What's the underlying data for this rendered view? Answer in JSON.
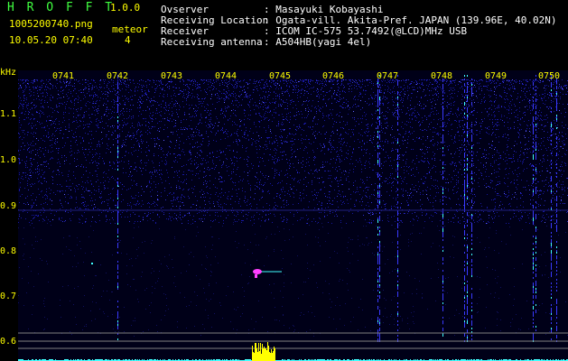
{
  "header": {
    "app_name": "H R O F F T",
    "version": "1.0.0",
    "filename": "1005200740.png",
    "datetime": "10.05.20 07:40",
    "meteor_label": "meteor",
    "meteor_count": "4",
    "observer_label": "Ovserver",
    "observer_value": ": Masayuki Kobayashi",
    "location_label": "Receiving Location",
    "location_value": ": Ogata-vill. Akita-Pref. JAPAN (139.96E, 40.02N)",
    "receiver_label": "Receiver",
    "receiver_value": ": ICOM IC-575 53.7492(@LCD)MHz USB",
    "antenna_label": "Receiving antenna",
    "antenna_value": ": A504HB(yagi 4el)"
  },
  "chart_data": {
    "type": "heatmap",
    "y_unit": "kHz",
    "x_ticks": [
      "0741",
      "0742",
      "0743",
      "0744",
      "0745",
      "0746",
      "0747",
      "0748",
      "0749",
      "0750"
    ],
    "y_ticks": [
      "1.1",
      "1.0",
      "0.9",
      "0.8",
      "0.7",
      "0.6"
    ],
    "ylim": [
      0.58,
      1.18
    ],
    "colors": {
      "background": "#000010",
      "noise": "#2020c0",
      "grid": "#808080",
      "signal": "#ffff00",
      "meteor": "#ff40ff",
      "trace": "#40ffff"
    }
  }
}
